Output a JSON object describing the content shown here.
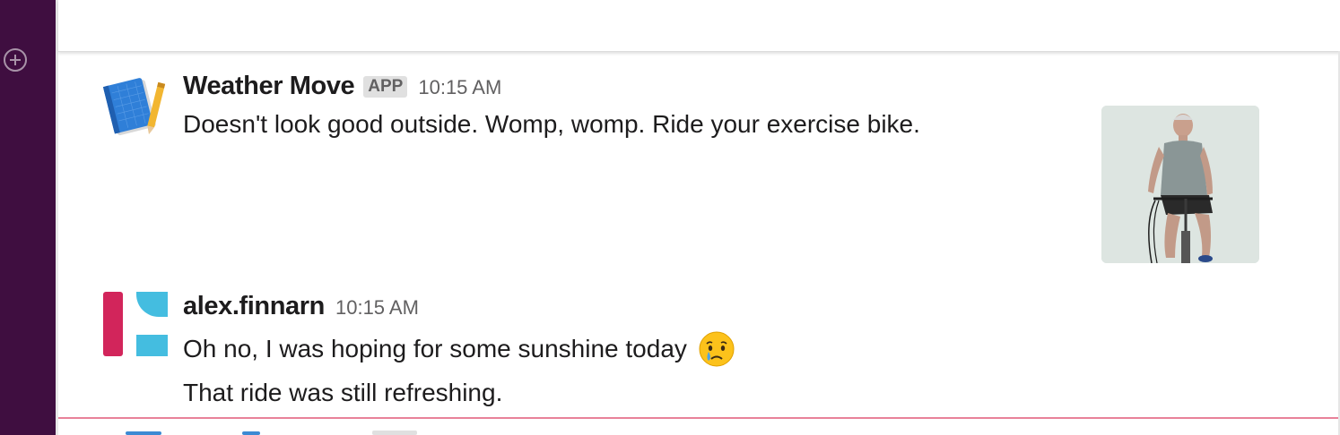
{
  "sidebar": {
    "add_icon": "circle-plus-icon"
  },
  "messages": [
    {
      "author": "Weather Move",
      "badge": "APP",
      "time": "10:15 AM",
      "text": "Doesn't look good outside. Womp, womp. Ride your exercise bike.",
      "avatar_icon": "notebook-pencil-icon",
      "attachment": "exercise-bike-photo"
    },
    {
      "author": "alex.finnarn",
      "time": "10:15 AM",
      "lines": [
        "Oh no, I was hoping for some sunshine today",
        "That ride was still refreshing."
      ],
      "emoji": "crying-face-emoji",
      "avatar_colors": [
        "#d2255b",
        "#44bde0"
      ]
    }
  ],
  "colors": {
    "sidebar": "#3f0e40",
    "new_divider": "#e8829a",
    "badge_bg": "#e0e0e0"
  }
}
